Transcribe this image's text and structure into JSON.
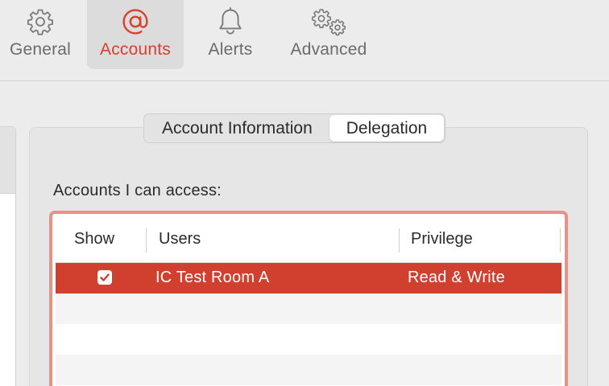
{
  "toolbar": {
    "items": [
      {
        "label": "General",
        "icon": "gear-icon"
      },
      {
        "label": "Accounts",
        "icon": "at-sign-icon",
        "selected": true
      },
      {
        "label": "Alerts",
        "icon": "bell-icon"
      },
      {
        "label": "Advanced",
        "icon": "double-gear-icon"
      }
    ]
  },
  "tabs": [
    {
      "label": "Account Information",
      "selected": false
    },
    {
      "label": "Delegation",
      "selected": true
    }
  ],
  "section_label": "Accounts I can access:",
  "table": {
    "columns": [
      "Show",
      "Users",
      "Privilege"
    ],
    "rows": [
      {
        "show": true,
        "user": "IC Test Room A",
        "privilege": "Read & Write",
        "selected": true
      }
    ]
  },
  "colors": {
    "accent": "#d8402f",
    "selection": "#d1402e",
    "focus_ring": "#e8918a"
  }
}
